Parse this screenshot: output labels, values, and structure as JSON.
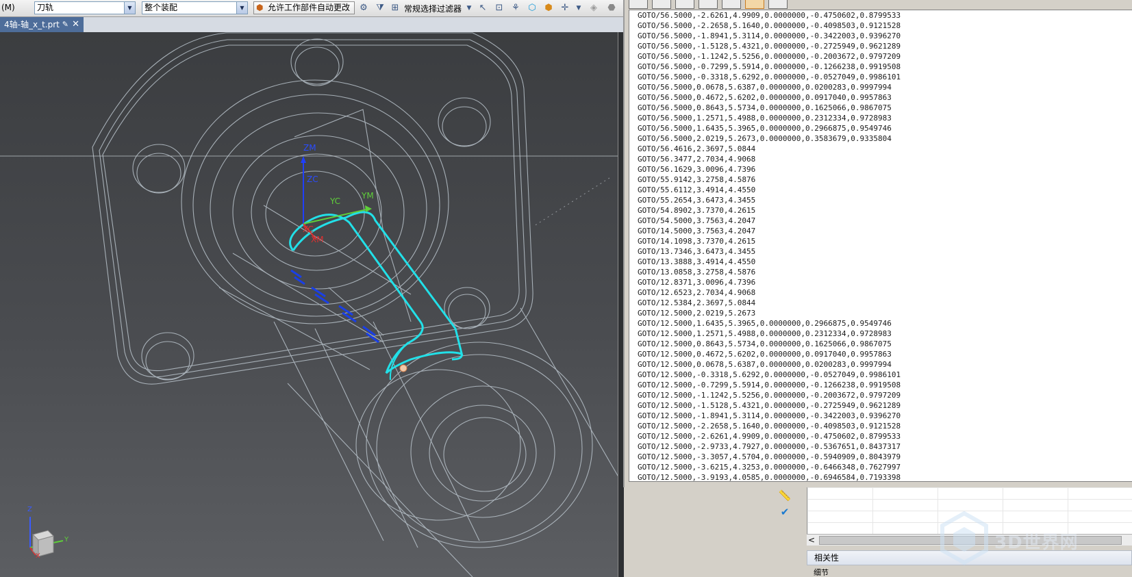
{
  "toolbar": {
    "menu_label": "(M)",
    "type_combo": "刀轨",
    "scope_combo": "整个装配",
    "allow_button": "允许工作部件自动更改",
    "filter_label": "常规选择过滤器"
  },
  "tab": {
    "title": "4轴-轴_x_t.prt"
  },
  "viewport": {
    "wcs_labels": {
      "zm": "ZM",
      "zc": "ZC",
      "yc": "YC",
      "ym": "YM",
      "xc": "XC",
      "xm": "XM"
    },
    "triad": {
      "z": "Z",
      "y": "Y",
      "x": "X"
    },
    "colors": {
      "toolpath": "#22e0e8",
      "wireframe": "#b9c3cb",
      "zaxis": "#1f3fff",
      "yaxis": "#5fcf3a",
      "xaxis": "#e03030"
    }
  },
  "info_lines": [
    "GOTO/56.5000,-2.6261,4.9909,0.0000000,-0.4750602,0.8799533",
    "GOTO/56.5000,-2.2658,5.1640,0.0000000,-0.4098503,0.9121528",
    "GOTO/56.5000,-1.8941,5.3114,0.0000000,-0.3422003,0.9396270",
    "GOTO/56.5000,-1.5128,5.4321,0.0000000,-0.2725949,0.9621289",
    "GOTO/56.5000,-1.1242,5.5256,0.0000000,-0.2003672,0.9797209",
    "GOTO/56.5000,-0.7299,5.5914,0.0000000,-0.1266238,0.9919508",
    "GOTO/56.5000,-0.3318,5.6292,0.0000000,-0.0527049,0.9986101",
    "GOTO/56.5000,0.0678,5.6387,0.0000000,0.0200283,0.9997994",
    "GOTO/56.5000,0.4672,5.6202,0.0000000,0.0917040,0.9957863",
    "GOTO/56.5000,0.8643,5.5734,0.0000000,0.1625066,0.9867075",
    "GOTO/56.5000,1.2571,5.4988,0.0000000,0.2312334,0.9728983",
    "GOTO/56.5000,1.6435,5.3965,0.0000000,0.2966875,0.9549746",
    "GOTO/56.5000,2.0219,5.2673,0.0000000,0.3583679,0.9335804",
    "GOTO/56.4616,2.3697,5.0844",
    "GOTO/56.3477,2.7034,4.9068",
    "GOTO/56.1629,3.0096,4.7396",
    "GOTO/55.9142,3.2758,4.5876",
    "GOTO/55.6112,3.4914,4.4550",
    "GOTO/55.2654,3.6473,4.3455",
    "GOTO/54.8902,3.7370,4.2615",
    "GOTO/54.5000,3.7563,4.2047",
    "GOTO/14.5000,3.7563,4.2047",
    "GOTO/14.1098,3.7370,4.2615",
    "GOTO/13.7346,3.6473,4.3455",
    "GOTO/13.3888,3.4914,4.4550",
    "GOTO/13.0858,3.2758,4.5876",
    "GOTO/12.8371,3.0096,4.7396",
    "GOTO/12.6523,2.7034,4.9068",
    "GOTO/12.5384,2.3697,5.0844",
    "GOTO/12.5000,2.0219,5.2673",
    "GOTO/12.5000,1.6435,5.3965,0.0000000,0.2966875,0.9549746",
    "GOTO/12.5000,1.2571,5.4988,0.0000000,0.2312334,0.9728983",
    "GOTO/12.5000,0.8643,5.5734,0.0000000,0.1625066,0.9867075",
    "GOTO/12.5000,0.4672,5.6202,0.0000000,0.0917040,0.9957863",
    "GOTO/12.5000,0.0678,5.6387,0.0000000,0.0200283,0.9997994",
    "GOTO/12.5000,-0.3318,5.6292,0.0000000,-0.0527049,0.9986101",
    "GOTO/12.5000,-0.7299,5.5914,0.0000000,-0.1266238,0.9919508",
    "GOTO/12.5000,-1.1242,5.5256,0.0000000,-0.2003672,0.9797209",
    "GOTO/12.5000,-1.5128,5.4321,0.0000000,-0.2725949,0.9621289",
    "GOTO/12.5000,-1.8941,5.3114,0.0000000,-0.3422003,0.9396270",
    "GOTO/12.5000,-2.2658,5.1640,0.0000000,-0.4098503,0.9121528",
    "GOTO/12.5000,-2.6261,4.9909,0.0000000,-0.4750602,0.8799533",
    "GOTO/12.5000,-2.9733,4.7927,0.0000000,-0.5367651,0.8437317",
    "GOTO/12.5000,-3.3057,4.5704,0.0000000,-0.5940909,0.8043979",
    "GOTO/12.5000,-3.6215,4.3253,0.0000000,-0.6466348,0.7627997",
    "GOTO/12.5000,-3.9193,4.0585,0.0000000,-0.6946584,0.7193398"
  ],
  "bottom_panel": {
    "scroll_left": "<",
    "section_1": "相关性",
    "section_2": "细节"
  },
  "watermark": {
    "text": "3D世界网"
  }
}
